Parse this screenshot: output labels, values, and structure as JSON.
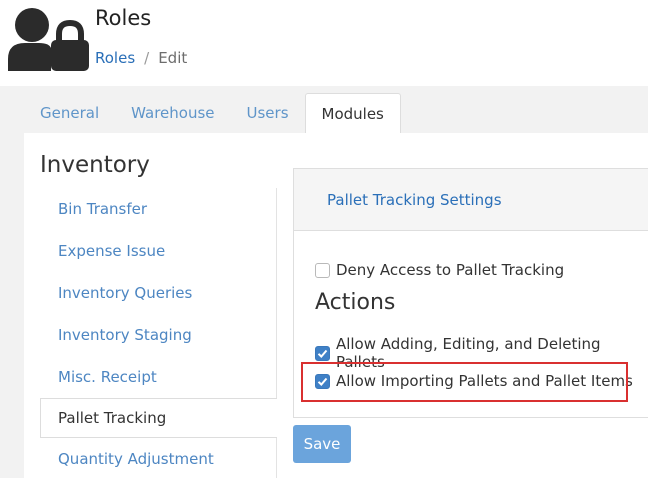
{
  "header": {
    "title": "Roles",
    "icon": "user-lock-icon"
  },
  "breadcrumb": {
    "link": "Roles",
    "separator": "/",
    "current": "Edit"
  },
  "tabs": [
    {
      "label": "General",
      "active": false
    },
    {
      "label": "Warehouse",
      "active": false
    },
    {
      "label": "Users",
      "active": false
    },
    {
      "label": "Modules",
      "active": true
    }
  ],
  "modules": {
    "heading": "Inventory",
    "items": [
      {
        "label": "Bin Transfer",
        "active": false
      },
      {
        "label": "Expense Issue",
        "active": false
      },
      {
        "label": "Inventory Queries",
        "active": false
      },
      {
        "label": "Inventory Staging",
        "active": false
      },
      {
        "label": "Misc. Receipt",
        "active": false
      },
      {
        "label": "Pallet Tracking",
        "active": true
      },
      {
        "label": "Quantity Adjustment",
        "active": false
      }
    ]
  },
  "settings": {
    "header": "Pallet Tracking Settings",
    "deny_access": {
      "label": "Deny Access to Pallet Tracking",
      "checked": false
    },
    "actions_heading": "Actions",
    "allow_edit": {
      "label": "Allow Adding, Editing, and Deleting Pallets",
      "checked": true
    },
    "allow_import": {
      "label": "Allow Importing Pallets and Pallet Items",
      "checked": true
    }
  },
  "save_label": "Save",
  "colors": {
    "link": "#2a6fb8",
    "checkbox_checked": "#3f80c6",
    "save_button": "#6ba4dc",
    "highlight": "#d93030"
  }
}
